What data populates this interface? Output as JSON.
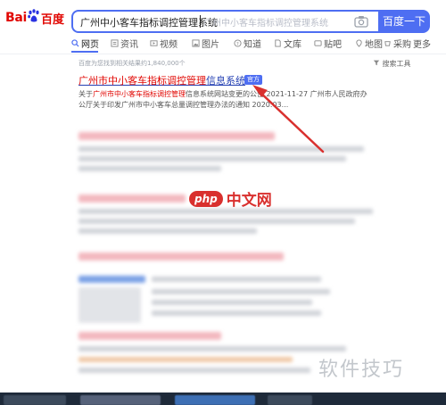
{
  "logo": {
    "bai": "Bai",
    "du": "百度"
  },
  "search": {
    "query": "广州中小客车指标调控管理系统",
    "suggestion": "广州中小客车指标调控管理系统",
    "button": "百度一下"
  },
  "tabs": [
    {
      "label": "网页",
      "icon": "search-icon",
      "active": true
    },
    {
      "label": "资讯",
      "icon": "news-icon"
    },
    {
      "label": "视频",
      "icon": "video-icon"
    },
    {
      "label": "图片",
      "icon": "image-icon"
    },
    {
      "label": "知道",
      "icon": "knowledge-icon"
    },
    {
      "label": "文库",
      "icon": "doc-icon"
    },
    {
      "label": "贴吧",
      "icon": "tieba-icon"
    },
    {
      "label": "地图",
      "icon": "map-icon"
    },
    {
      "label": "采购",
      "icon": "shopping-icon"
    },
    {
      "label": "更多",
      "icon": "more-icon"
    }
  ],
  "results_count": "百度为您找到相关结果约1,840,000个",
  "search_tools": "搜索工具",
  "first_result": {
    "title_hl": "广州市中小客车指标调控管理",
    "title_rest": "信息系统",
    "badge": "官方",
    "desc_part1": "关于",
    "desc_hl": "广州市中小客车指标调控管理",
    "desc_part2": "信息系统网站变更的公告 2021-11-27 广州市人民政府办公厅关于印发广州市中小客车总量调控管理办法的通知 2020.03..."
  },
  "watermark": {
    "php": "php",
    "cn": "中文网",
    "bottom": "软件技巧"
  },
  "colors": {
    "accent": "#4e6ef2",
    "brand_red": "#e10602",
    "link": "#2440b3",
    "arrow": "#d9302e"
  }
}
